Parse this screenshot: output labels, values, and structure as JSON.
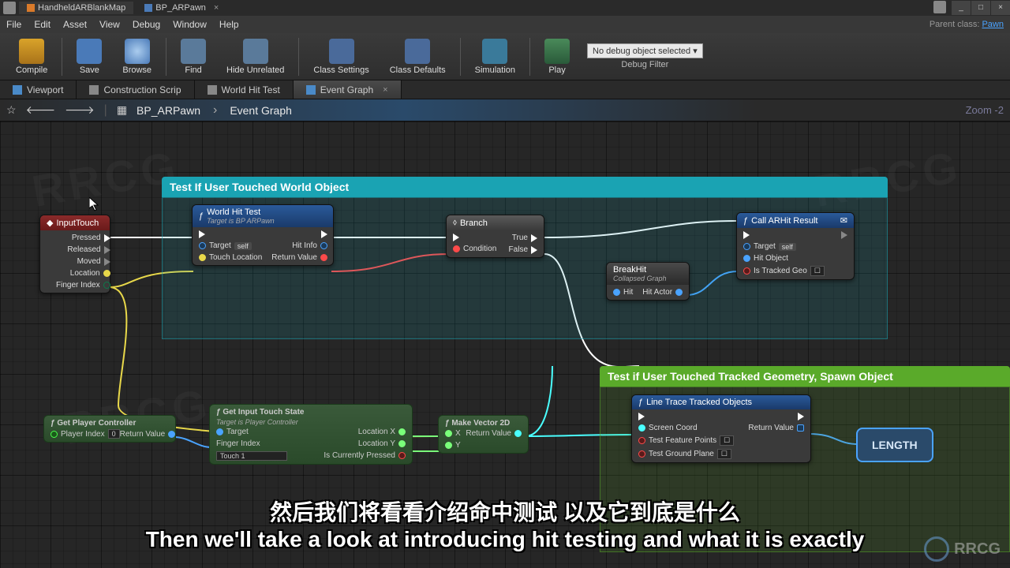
{
  "titlebar": {
    "tab1": "HandheldARBlankMap",
    "tab2": "BP_ARPawn"
  },
  "window_controls": {
    "min": "_",
    "max": "□",
    "close": "×"
  },
  "menu": [
    "File",
    "Edit",
    "Asset",
    "View",
    "Debug",
    "Window",
    "Help"
  ],
  "parent_class_label": "Parent class:",
  "parent_class_value": "Pawn",
  "toolbar": {
    "compile": "Compile",
    "save": "Save",
    "browse": "Browse",
    "find": "Find",
    "hide_unrelated": "Hide Unrelated",
    "class_settings": "Class Settings",
    "class_defaults": "Class Defaults",
    "simulation": "Simulation",
    "play": "Play",
    "debug_select": "No debug object selected ▾",
    "debug_filter": "Debug Filter"
  },
  "mode_tabs": {
    "viewport": "Viewport",
    "construction": "Construction Scrip",
    "world_hit": "World Hit Test",
    "event_graph": "Event Graph"
  },
  "breadcrumb": {
    "root": "BP_ARPawn",
    "leaf": "Event Graph",
    "zoom": "Zoom -2"
  },
  "comments": {
    "teal": "Test If User Touched World Object",
    "green": "Test if User Touched Tracked Geometry, Spawn Object"
  },
  "nodes": {
    "input_touch": {
      "title": "InputTouch",
      "pressed": "Pressed",
      "released": "Released",
      "moved": "Moved",
      "location": "Location",
      "finger_index": "Finger Index"
    },
    "world_hit_test": {
      "title": "World Hit Test",
      "subtitle": "Target is BP ARPawn",
      "target": "Target",
      "self": "self",
      "touch_location": "Touch Location",
      "hit_info": "Hit Info",
      "return_value": "Return Value"
    },
    "branch": {
      "title": "Branch",
      "condition": "Condition",
      "true": "True",
      "false": "False"
    },
    "break_hit": {
      "title": "BreakHit",
      "subtitle": "Collapsed Graph",
      "hit": "Hit",
      "hit_actor": "Hit Actor"
    },
    "call_arhit": {
      "title": "Call ARHit Result",
      "target": "Target",
      "self": "self",
      "hit_object": "Hit Object",
      "is_tracked_geo": "Is Tracked Geo"
    },
    "get_player_controller": {
      "title": "Get Player Controller",
      "player_index": "Player Index",
      "value": "0",
      "return_value": "Return Value"
    },
    "get_input_touch": {
      "title": "Get Input Touch State",
      "subtitle": "Target is Player Controller",
      "target": "Target",
      "finger_index": "Finger Index",
      "touch1": "Touch 1",
      "location_x": "Location X",
      "location_y": "Location Y",
      "is_pressed": "Is Currently Pressed"
    },
    "make_vector": {
      "title": "Make Vector 2D",
      "x": "X",
      "y": "Y",
      "return_value": "Return Value"
    },
    "line_trace": {
      "title": "Line Trace Tracked Objects",
      "screen_coord": "Screen Coord",
      "test_feature": "Test Feature Points",
      "test_ground": "Test Ground Plane",
      "return_value": "Return Value"
    },
    "length": "LENGTH"
  },
  "subtitles": {
    "cn": "然后我们将看看介绍命中测试 以及它到底是什么",
    "en": "Then we'll take a look at introducing hit testing and what it is exactly"
  },
  "watermark": "RRCG"
}
